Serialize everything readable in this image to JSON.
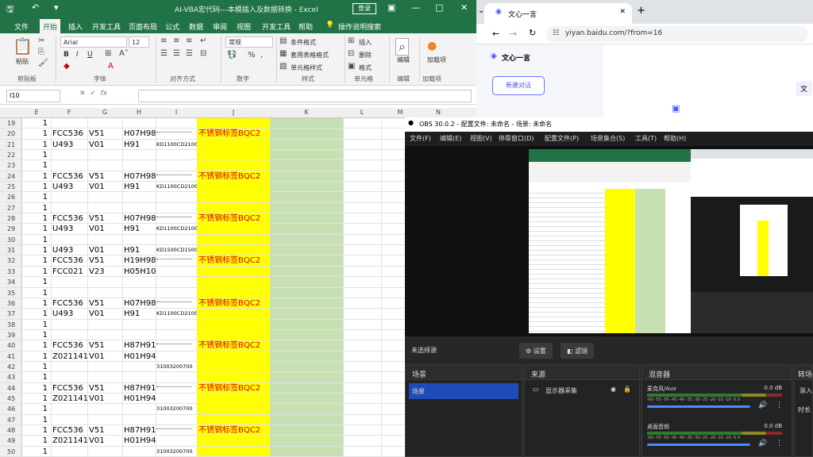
{
  "excel": {
    "title": "AI-VBA宏代码---本模插入及数据转换 - Excel",
    "login": "登录",
    "tabs": [
      "文件",
      "开始",
      "插入",
      "开发工具",
      "页面布局",
      "公式",
      "数据",
      "审阅",
      "视图",
      "开发工具",
      "帮助"
    ],
    "tell_me": "操作说明搜索",
    "font_name": "Arial",
    "font_size": "12",
    "number_format": "常规",
    "groups": [
      "剪贴板",
      "字体",
      "对齐方式",
      "数字",
      "样式",
      "单元格",
      "编辑",
      "加载项"
    ],
    "ribbon": {
      "paste": "粘贴",
      "conditional": "条件格式",
      "table_format": "套用表格格式",
      "cell_style": "单元格样式",
      "insert": "插入",
      "delete": "删除",
      "format": "格式",
      "edit": "编辑",
      "addin": "加载项"
    },
    "namebox": "I10",
    "columns": [
      "E",
      "F",
      "G",
      "H",
      "I",
      "J",
      "K",
      "L",
      "M",
      "N"
    ],
    "rows": [
      {
        "n": "19",
        "e": "1"
      },
      {
        "n": "20",
        "e": "1",
        "f": "FCC536",
        "g": "V51",
        "h": "H07H98",
        "i": "tiny",
        "j": "不锈钢标签BQC2"
      },
      {
        "n": "21",
        "e": "1",
        "f": "U493",
        "g": "V01",
        "h": "H91",
        "i": "KD1100CD2100"
      },
      {
        "n": "22",
        "e": "1"
      },
      {
        "n": "23",
        "e": "1"
      },
      {
        "n": "24",
        "e": "1",
        "f": "FCC536",
        "g": "V51",
        "h": "H07H98",
        "i": "tiny",
        "j": "不锈钢标签BQC2"
      },
      {
        "n": "25",
        "e": "1",
        "f": "U493",
        "g": "V01",
        "h": "H91",
        "i": "KD1100CD2100"
      },
      {
        "n": "26",
        "e": "1"
      },
      {
        "n": "27",
        "e": "1"
      },
      {
        "n": "28",
        "e": "1",
        "f": "FCC536",
        "g": "V51",
        "h": "H07H98",
        "i": "tiny",
        "j": "不锈钢标签BQC2"
      },
      {
        "n": "29",
        "e": "1",
        "f": "U493",
        "g": "V01",
        "h": "H91",
        "i": "KD1100CD2100"
      },
      {
        "n": "30",
        "e": "1"
      },
      {
        "n": "31",
        "e": "1",
        "f": "U493",
        "g": "V01",
        "h": "H91",
        "i": "KD1500CD1500"
      },
      {
        "n": "32",
        "e": "1",
        "f": "FCC536",
        "g": "V51",
        "h": "H19H98",
        "i": "tiny",
        "j": "不锈钢标签BQC2"
      },
      {
        "n": "33",
        "e": "1",
        "f": "FCC021",
        "g": "V23",
        "h": "H05H10"
      },
      {
        "n": "34",
        "e": "1"
      },
      {
        "n": "35",
        "e": "1"
      },
      {
        "n": "36",
        "e": "1",
        "f": "FCC536",
        "g": "V51",
        "h": "H07H98",
        "i": "tiny",
        "j": "不锈钢标签BQC2"
      },
      {
        "n": "37",
        "e": "1",
        "f": "U493",
        "g": "V01",
        "h": "H91",
        "i": "KD1100CD2100"
      },
      {
        "n": "38",
        "e": "1"
      },
      {
        "n": "39",
        "e": "1"
      },
      {
        "n": "40",
        "e": "1",
        "f": "FCC536",
        "g": "V51",
        "h": "H87H91",
        "i": "tiny",
        "j": "不锈钢标签BQC2"
      },
      {
        "n": "41",
        "e": "1",
        "f": "Z021141",
        "g": "V01",
        "h": "H01H94"
      },
      {
        "n": "42",
        "e": "1",
        "i": "31003200700"
      },
      {
        "n": "43",
        "e": "1"
      },
      {
        "n": "44",
        "e": "1",
        "f": "FCC536",
        "g": "V51",
        "h": "H87H91",
        "i": "tiny",
        "j": "不锈钢标签BQC2"
      },
      {
        "n": "45",
        "e": "1",
        "f": "Z021141",
        "g": "V01",
        "h": "H01H94"
      },
      {
        "n": "46",
        "e": "1",
        "i": "31003200700"
      },
      {
        "n": "47",
        "e": "1"
      },
      {
        "n": "48",
        "e": "1",
        "f": "FCC536",
        "g": "V51",
        "h": "H87H91",
        "i": "tiny",
        "j": "不锈钢标签BQC2"
      },
      {
        "n": "49",
        "e": "1",
        "f": "Z021141",
        "g": "V01",
        "h": "H01H94"
      },
      {
        "n": "50",
        "e": "1",
        "i": "31003200700"
      }
    ]
  },
  "browser": {
    "tab_title": "文心一言",
    "url": "yiyan.baidu.com/?from=16",
    "brand": "文心一言",
    "new_chat": "新建对话",
    "right_snip": "文"
  },
  "obs": {
    "title": "OBS 30.0.2 - 配置文件: 未命名 - 场景: 未命名",
    "menu": [
      "文件(F)",
      "编辑(E)",
      "视图(V)",
      "停靠窗口(D)",
      "配置文件(P)",
      "场景集合(S)",
      "工具(T)",
      "帮助(H)"
    ],
    "no_source": "未选择源",
    "settings_btn": "设置",
    "filters_btn": "滤镜",
    "docks": {
      "scenes": "场景",
      "sources": "来源",
      "mixer": "混音器",
      "transitions": "转场"
    },
    "scene_item": "场景",
    "source_item": "显示器采集",
    "mixer": [
      {
        "name": "麦克风/Aux",
        "db": "0.0 dB"
      },
      {
        "name": "桌面音频",
        "db": "0.0 dB"
      }
    ],
    "meter_ticks": "-60 -55 -50 -45 -40 -35 -30 -25 -20 -15 -10 -5 0",
    "transition_snip": "渐入",
    "duration_snip": "时长"
  },
  "colors": {
    "excel_green": "#217346",
    "highlight_yellow": "#ffff00",
    "highlight_green": "#c6e0b4",
    "red_text": "#e00000"
  }
}
